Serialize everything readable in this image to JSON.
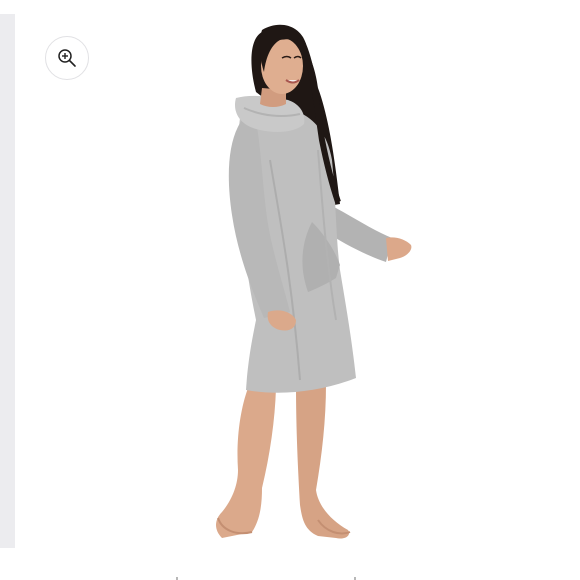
{
  "gallery": {
    "zoom_button": {
      "icon": "zoom-in-icon"
    },
    "image": {
      "description_icon": "product-photo",
      "colors": {
        "garment": "#bcbcbc",
        "skin": "#dba98b",
        "hair": "#1f1714",
        "background": "#ffffff"
      }
    },
    "rail_color": "#ececef"
  }
}
